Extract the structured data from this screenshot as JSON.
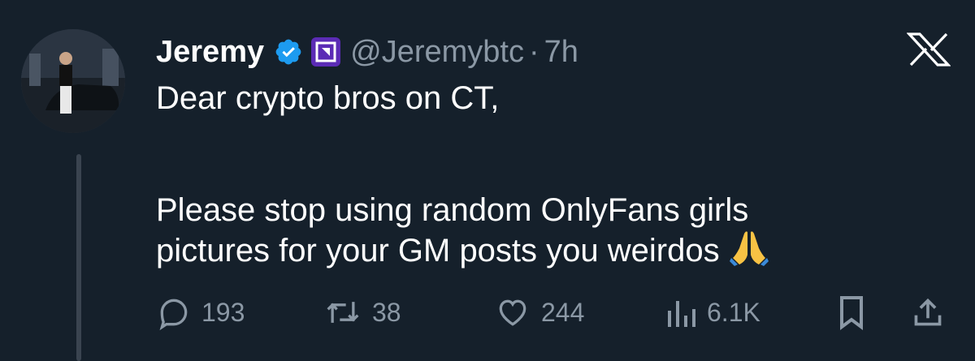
{
  "author": {
    "display_name": "Jeremy",
    "handle": "@Jeremybtc",
    "separator": "·",
    "time": "7h"
  },
  "tweet": {
    "line1": "Dear crypto bros on CT,",
    "line2": "Please stop using random OnlyFans girls",
    "line3": "pictures for your GM posts you weirdos",
    "emoji": "🙏"
  },
  "metrics": {
    "replies": "193",
    "retweets": "38",
    "likes": "244",
    "views": "6.1K"
  },
  "icons": {
    "verified": "verified-check-icon",
    "affiliate": "affiliate-badge-icon",
    "brand": "x-logo-icon"
  },
  "colors": {
    "background": "#15202b",
    "verified": "#1d9bf0",
    "muted": "#8b98a5",
    "affiliate_badge": "#5b2bb5"
  }
}
